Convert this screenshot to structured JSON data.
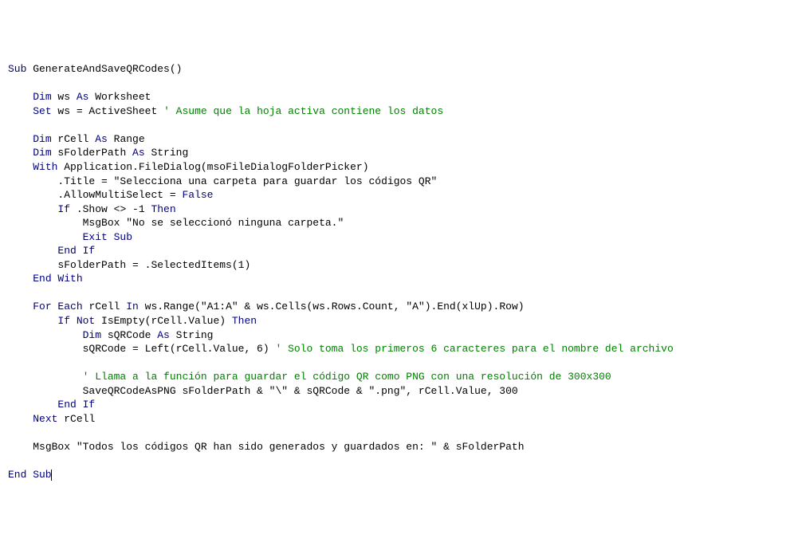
{
  "code": {
    "l1_sub": "Sub",
    "l1_name": " GenerateAndSaveQRCodes()",
    "l3_dim": "Dim",
    "l3_ws": " ws ",
    "l3_as": "As",
    "l3_type": " Worksheet",
    "l4_set": "Set",
    "l4_assign": " ws = ActiveSheet ",
    "l4_cm": "' Asume que la hoja activa contiene los datos",
    "l6_dim": "Dim",
    "l6_rest": " rCell ",
    "l6_as": "As",
    "l6_type": " Range",
    "l7_dim": "Dim",
    "l7_rest": " sFolderPath ",
    "l7_as": "As",
    "l7_type": " String",
    "l8_with": "With",
    "l8_rest": " Application.FileDialog(msoFileDialogFolderPicker)",
    "l9": ".Title = \"Selecciona una carpeta para guardar los códigos QR\"",
    "l10_a": ".AllowMultiSelect = ",
    "l10_false": "False",
    "l11_if": "If",
    "l11_cond": " .Show <> -1 ",
    "l11_then": "Then",
    "l12": "MsgBox \"No se seleccionó ninguna carpeta.\"",
    "l13": "Exit Sub",
    "l14": "End If",
    "l15": "sFolderPath = .SelectedItems(1)",
    "l16": "End With",
    "l18_for": "For Each",
    "l18_a": " rCell ",
    "l18_in": "In",
    "l18_b": " ws.Range(\"A1:A\" & ws.Cells(ws.Rows.Count, \"A\").End(xlUp).Row)",
    "l19_if": "If Not",
    "l19_a": " IsEmpty(rCell.Value) ",
    "l19_then": "Then",
    "l20_dim": "Dim",
    "l20_a": " sQRCode ",
    "l20_as": "As",
    "l20_type": " String",
    "l21_a": "sQRCode = Left(rCell.Value, 6) ",
    "l21_cm": "' Solo toma los primeros 6 caracteres para el nombre del archivo",
    "l23_cm": "' Llama a la función para guardar el código QR como PNG con una resolución de 300x300",
    "l24": "SaveQRCodeAsPNG sFolderPath & \"\\\" & sQRCode & \".png\", rCell.Value, 300",
    "l25": "End If",
    "l26_next": "Next",
    "l26_a": " rCell",
    "l28": "MsgBox \"Todos los códigos QR han sido generados y guardados en: \" & sFolderPath",
    "l30": "End Sub"
  }
}
